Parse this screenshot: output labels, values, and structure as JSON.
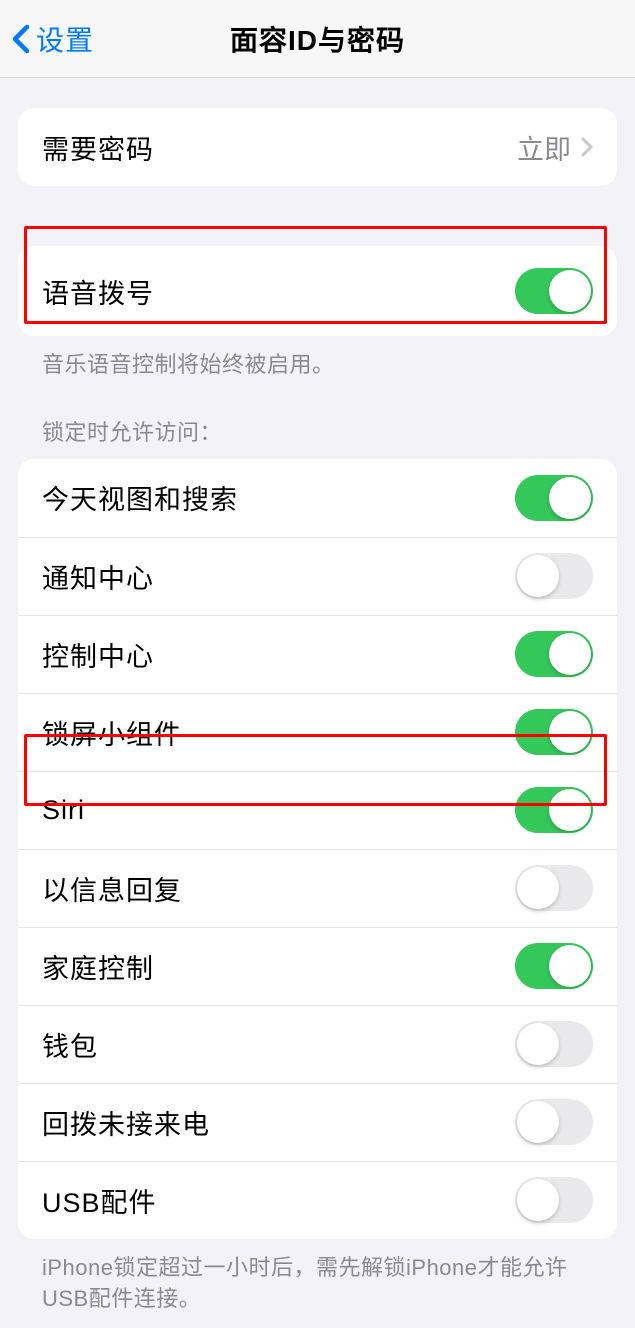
{
  "header": {
    "back_label": "设置",
    "title": "面容ID与密码"
  },
  "require_passcode": {
    "label": "需要密码",
    "value": "立即"
  },
  "voice_dial": {
    "label": "语音拨号",
    "footer": "音乐语音控制将始终被启用。",
    "on": true
  },
  "allow_access": {
    "header": "锁定时允许访问：",
    "items": [
      {
        "label": "今天视图和搜索",
        "on": true
      },
      {
        "label": "通知中心",
        "on": false
      },
      {
        "label": "控制中心",
        "on": true
      },
      {
        "label": "锁屏小组件",
        "on": true
      },
      {
        "label": "Siri",
        "on": true
      },
      {
        "label": "以信息回复",
        "on": false
      },
      {
        "label": "家庭控制",
        "on": true
      },
      {
        "label": "钱包",
        "on": false
      },
      {
        "label": "回拨未接来电",
        "on": false
      },
      {
        "label": "USB配件",
        "on": false
      }
    ],
    "footer": "iPhone锁定超过一小时后，需先解锁iPhone才能允许USB配件连接。"
  }
}
